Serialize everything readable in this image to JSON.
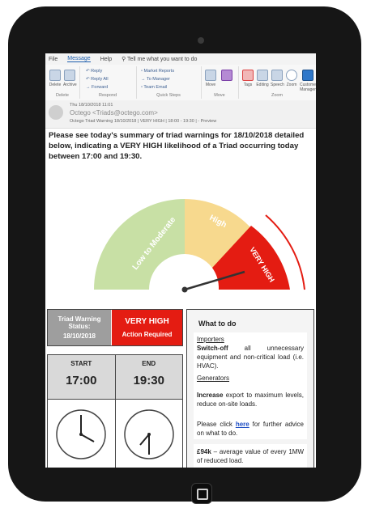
{
  "ribbon": {
    "tabs": [
      "File",
      "Message",
      "Help",
      "Tell me what you want to do"
    ],
    "delete_label": "Delete",
    "archive_label": "Archive",
    "reply_label": "Reply",
    "reply_all_label": "Reply All",
    "forward_label": "Forward",
    "quick_step_1": "Market Reports",
    "quick_step_2": "To Manager",
    "quick_step_3": "Team Email",
    "move_label": "Move",
    "tags_label": "Tags",
    "editing_label": "Editing",
    "speech_label": "Speech",
    "zoom_label": "Zoom",
    "custom_label": "Customer Manager",
    "groups": [
      "Delete",
      "Respond",
      "Quick Steps",
      "Move",
      "Zoom"
    ]
  },
  "message": {
    "date": "Thu 18/10/2018 11:01",
    "from": "Octego <Triads@octego.com>",
    "subject": "Octego Triad Warning 18/10/2018 | VERY HIGH | 18:00 - 19:30 | - Preview"
  },
  "intro": "Please see today's summary of triad warnings for 18/10/2018 detailed below, indicating a VERY HIGH likelihood of a Triad occurring today between 17:00 and 19:30.",
  "gauge": {
    "low": "Low to Moderate",
    "high": "High",
    "very_high": "VERY HIGH",
    "action": "ACTION REQUIRED",
    "colors": {
      "low": "#c8e0a5",
      "high": "#f7d98e",
      "very_high": "#e41c12"
    }
  },
  "status": {
    "label": "Triad Warning Status:",
    "date": "18/10/2018",
    "level": "VERY HIGH",
    "action": "Action Required"
  },
  "times": {
    "start_label": "START",
    "start": "17:00",
    "end_label": "END",
    "end": "19:30"
  },
  "todo": {
    "title": "What to do",
    "importers_head": "Importers",
    "importers_bold": "Switch-off",
    "importers_text": "all unnecessary equipment and non-critical load (i.e. HVAC).",
    "generators_head": "Generators",
    "generators_bold": "Increase",
    "generators_text": "export to maximum levels, reduce on-site loads.",
    "click_pre": "Please click",
    "click_link": "here",
    "click_post": "for further advice on what to do.",
    "saving_bold": "£94k",
    "saving_text": "– average value of every 1MW of reduced load."
  }
}
